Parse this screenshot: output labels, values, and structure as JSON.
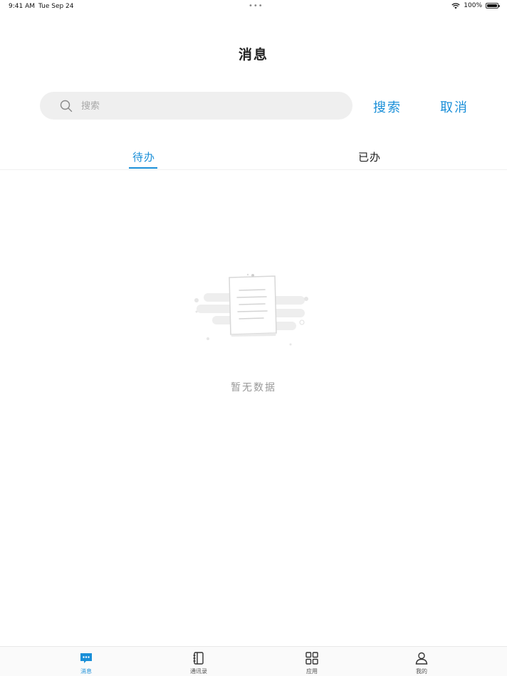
{
  "status_bar": {
    "time": "9:41 AM",
    "date": "Tue Sep 24",
    "dots": "•••",
    "battery": "100%"
  },
  "header": {
    "title": "消息"
  },
  "search": {
    "placeholder": "搜索",
    "value": "",
    "search_label": "搜索",
    "cancel_label": "取消"
  },
  "tabs": [
    {
      "label": "待办",
      "active": true
    },
    {
      "label": "已办",
      "active": false
    }
  ],
  "empty_state": {
    "text": "暂无数据"
  },
  "tabbar": [
    {
      "label": "消息",
      "icon": "message-icon",
      "active": true
    },
    {
      "label": "通讯录",
      "icon": "contacts-icon",
      "active": false
    },
    {
      "label": "应用",
      "icon": "apps-grid-icon",
      "active": false
    },
    {
      "label": "我的",
      "icon": "profile-icon",
      "active": false
    }
  ],
  "colors": {
    "accent": "#1a8fd8",
    "search_bg": "#efefef",
    "muted_text": "#999999"
  }
}
